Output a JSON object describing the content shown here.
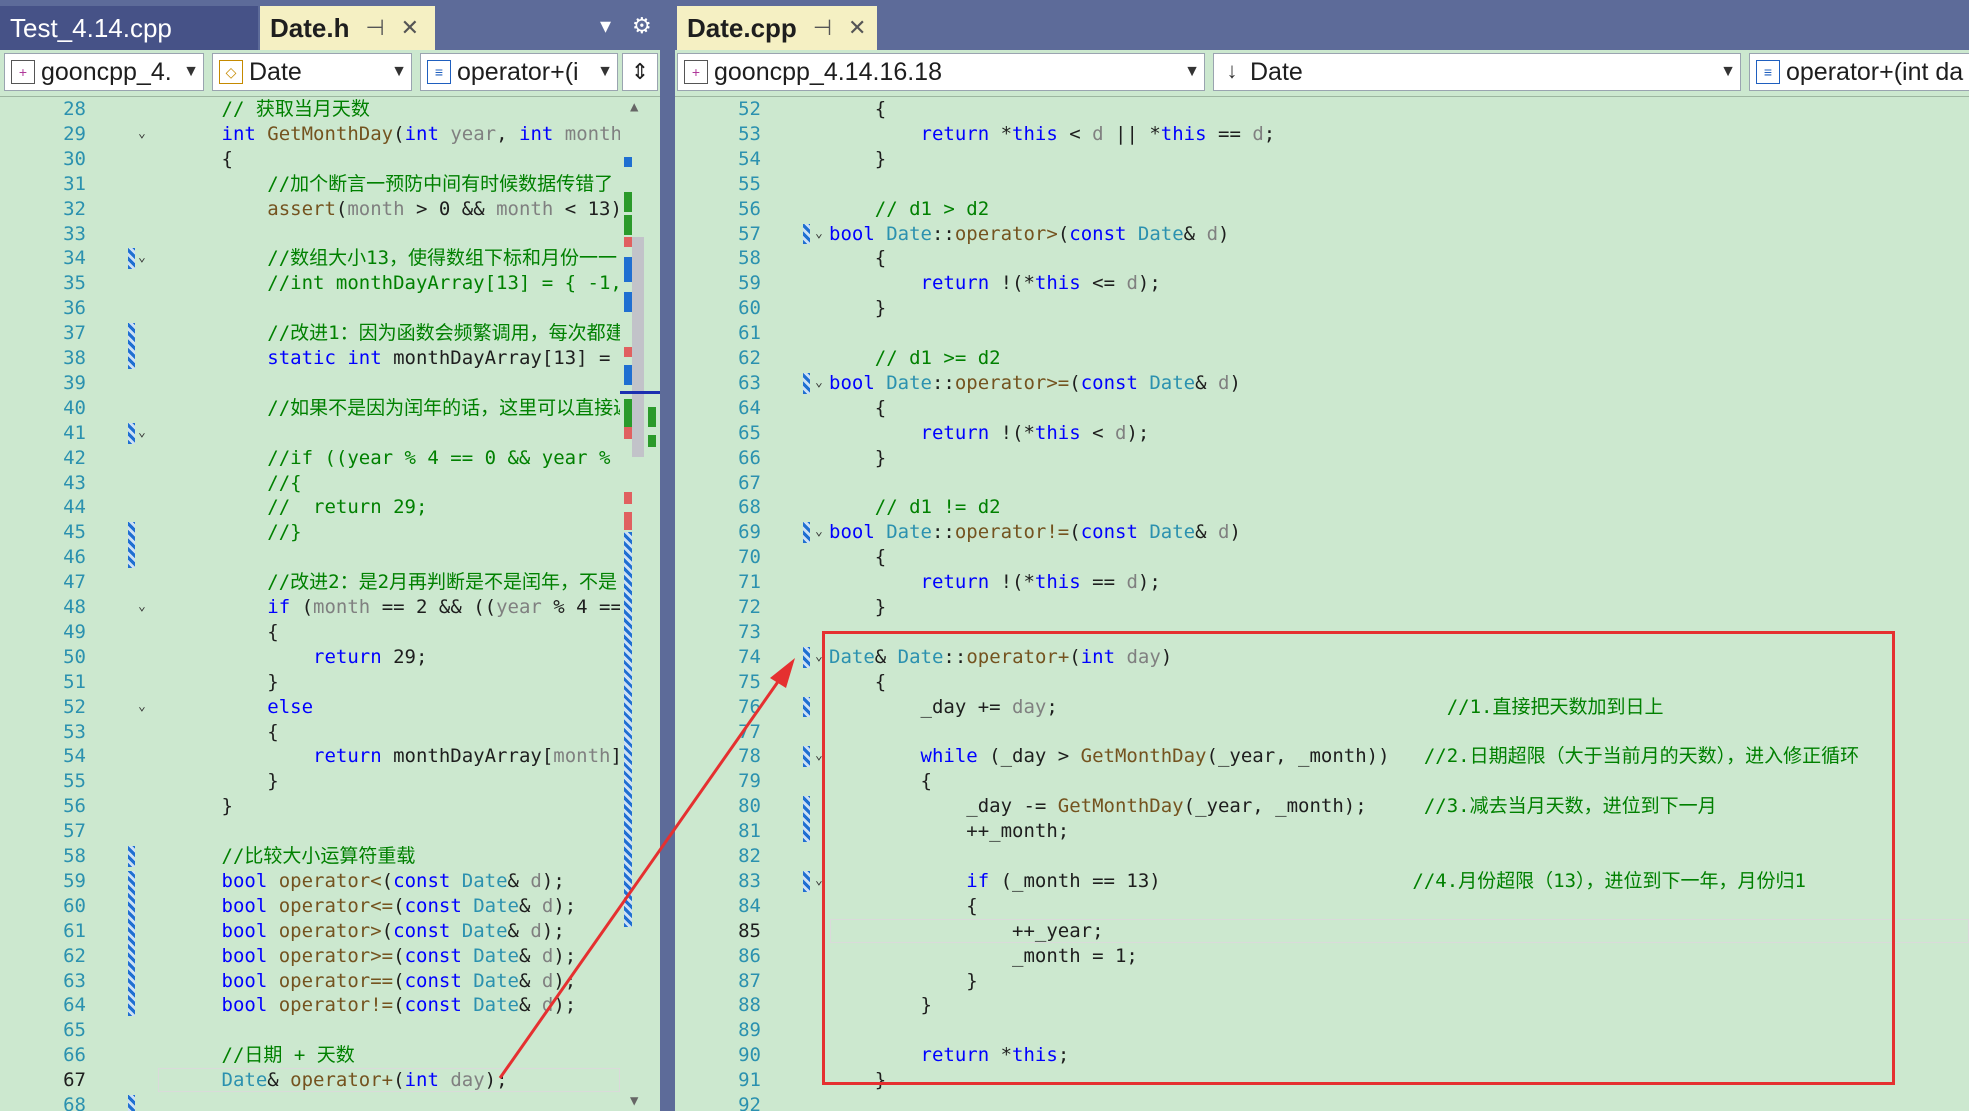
{
  "left_pane": {
    "tabs": [
      {
        "label": "Test_4.14.cpp",
        "active": false
      },
      {
        "label": "Date.h",
        "active": true
      }
    ],
    "tab_pin": "⊣",
    "tab_close": "✕",
    "tab_dropdown": "▾",
    "tab_settings": "⚙",
    "nav": {
      "project": "gooncpp_4.",
      "scope": "Date",
      "member": "operator+(i"
    }
  },
  "right_pane": {
    "tabs": [
      {
        "label": "Date.cpp",
        "active": true
      }
    ],
    "tab_pin": "⊣",
    "tab_close": "✕",
    "nav": {
      "project": "gooncpp_4.14.16.18",
      "scope": "Date",
      "member": "operator+(int da"
    }
  },
  "left_code": [
    {
      "n": "28",
      "parts": [
        [
          "cm",
          "        // 获取当月天数"
        ]
      ]
    },
    {
      "n": "29",
      "parts": [
        [
          "kw",
          "        int "
        ],
        [
          "fn",
          "GetMonthDay"
        ],
        [
          "op",
          "("
        ],
        [
          "kw",
          "int "
        ],
        [
          "pr",
          "year"
        ],
        [
          "op",
          ", "
        ],
        [
          "kw",
          "int "
        ],
        [
          "pr",
          "month"
        ],
        [
          "op",
          ")"
        ]
      ]
    },
    {
      "n": "30",
      "parts": [
        [
          "op",
          "        {"
        ]
      ]
    },
    {
      "n": "31",
      "parts": [
        [
          "cm",
          "            //加个断言一预防中间有时候数据传错了"
        ]
      ]
    },
    {
      "n": "32",
      "parts": [
        [
          "fn",
          "            assert"
        ],
        [
          "op",
          "("
        ],
        [
          "pr",
          "month"
        ],
        [
          "op",
          " > 0 && "
        ],
        [
          "pr",
          "month"
        ],
        [
          "op",
          " < 13);"
        ]
      ]
    },
    {
      "n": "33",
      "parts": [
        [
          "op",
          ""
        ]
      ]
    },
    {
      "n": "34",
      "parts": [
        [
          "cm",
          "            //数组大小13，使得数组下标和月份一一"
        ]
      ]
    },
    {
      "n": "35",
      "parts": [
        [
          "cm",
          "            //int monthDayArray[13] = { -1,"
        ]
      ]
    },
    {
      "n": "36",
      "parts": [
        [
          "op",
          ""
        ]
      ]
    },
    {
      "n": "37",
      "parts": [
        [
          "cm",
          "            //改进1：因为函数会频繁调用，每次都建"
        ]
      ]
    },
    {
      "n": "38",
      "parts": [
        [
          "kw",
          "            static int "
        ],
        [
          "op",
          "monthDayArray[13] = {"
        ]
      ]
    },
    {
      "n": "39",
      "parts": [
        [
          "op",
          ""
        ]
      ]
    },
    {
      "n": "40",
      "parts": [
        [
          "cm",
          "            //如果不是因为闰年的话，这里可以直接返"
        ]
      ]
    },
    {
      "n": "41",
      "parts": [
        [
          "op",
          ""
        ]
      ]
    },
    {
      "n": "42",
      "parts": [
        [
          "cm",
          "            //if ((year % 4 == 0 && year % 1"
        ]
      ]
    },
    {
      "n": "43",
      "parts": [
        [
          "cm",
          "            //{"
        ]
      ]
    },
    {
      "n": "44",
      "parts": [
        [
          "cm",
          "            //  return 29;"
        ]
      ]
    },
    {
      "n": "45",
      "parts": [
        [
          "cm",
          "            //}"
        ]
      ]
    },
    {
      "n": "46",
      "parts": [
        [
          "op",
          ""
        ]
      ]
    },
    {
      "n": "47",
      "parts": [
        [
          "cm",
          "            //改进2：是2月再判断是不是闰年，不是"
        ]
      ]
    },
    {
      "n": "48",
      "parts": [
        [
          "kw",
          "            if "
        ],
        [
          "op",
          "("
        ],
        [
          "pr",
          "month"
        ],
        [
          "op",
          " == 2 && (("
        ],
        [
          "pr",
          "year"
        ],
        [
          "op",
          " % 4 == "
        ]
      ]
    },
    {
      "n": "49",
      "parts": [
        [
          "op",
          "            {"
        ]
      ]
    },
    {
      "n": "50",
      "parts": [
        [
          "kw",
          "                return "
        ],
        [
          "op",
          "29;"
        ]
      ]
    },
    {
      "n": "51",
      "parts": [
        [
          "op",
          "            }"
        ]
      ]
    },
    {
      "n": "52",
      "parts": [
        [
          "kw",
          "            else"
        ]
      ]
    },
    {
      "n": "53",
      "parts": [
        [
          "op",
          "            {"
        ]
      ]
    },
    {
      "n": "54",
      "parts": [
        [
          "kw",
          "                return "
        ],
        [
          "op",
          "monthDayArray["
        ],
        [
          "pr",
          "month"
        ],
        [
          "op",
          "],"
        ]
      ]
    },
    {
      "n": "55",
      "parts": [
        [
          "op",
          "            }"
        ]
      ]
    },
    {
      "n": "56",
      "parts": [
        [
          "op",
          "        }"
        ]
      ]
    },
    {
      "n": "57",
      "parts": [
        [
          "op",
          ""
        ]
      ]
    },
    {
      "n": "58",
      "parts": [
        [
          "cm",
          "        //比较大小运算符重载"
        ]
      ]
    },
    {
      "n": "59",
      "parts": [
        [
          "kw",
          "        bool "
        ],
        [
          "fn",
          "operator<"
        ],
        [
          "op",
          "("
        ],
        [
          "kw",
          "const "
        ],
        [
          "ty",
          "Date"
        ],
        [
          "op",
          "& "
        ],
        [
          "pr",
          "d"
        ],
        [
          "op",
          ");"
        ]
      ]
    },
    {
      "n": "60",
      "parts": [
        [
          "kw",
          "        bool "
        ],
        [
          "fn",
          "operator<="
        ],
        [
          "op",
          "("
        ],
        [
          "kw",
          "const "
        ],
        [
          "ty",
          "Date"
        ],
        [
          "op",
          "& "
        ],
        [
          "pr",
          "d"
        ],
        [
          "op",
          ");"
        ]
      ]
    },
    {
      "n": "61",
      "parts": [
        [
          "kw",
          "        bool "
        ],
        [
          "fn",
          "operator>"
        ],
        [
          "op",
          "("
        ],
        [
          "kw",
          "const "
        ],
        [
          "ty",
          "Date"
        ],
        [
          "op",
          "& "
        ],
        [
          "pr",
          "d"
        ],
        [
          "op",
          ");"
        ]
      ]
    },
    {
      "n": "62",
      "parts": [
        [
          "kw",
          "        bool "
        ],
        [
          "fn",
          "operator>="
        ],
        [
          "op",
          "("
        ],
        [
          "kw",
          "const "
        ],
        [
          "ty",
          "Date"
        ],
        [
          "op",
          "& "
        ],
        [
          "pr",
          "d"
        ],
        [
          "op",
          ");"
        ]
      ]
    },
    {
      "n": "63",
      "parts": [
        [
          "kw",
          "        bool "
        ],
        [
          "fn",
          "operator=="
        ],
        [
          "op",
          "("
        ],
        [
          "kw",
          "const "
        ],
        [
          "ty",
          "Date"
        ],
        [
          "op",
          "& "
        ],
        [
          "pr",
          "d"
        ],
        [
          "op",
          ");"
        ]
      ]
    },
    {
      "n": "64",
      "parts": [
        [
          "kw",
          "        bool "
        ],
        [
          "fn",
          "operator!="
        ],
        [
          "op",
          "("
        ],
        [
          "kw",
          "const "
        ],
        [
          "ty",
          "Date"
        ],
        [
          "op",
          "& "
        ],
        [
          "pr",
          "d"
        ],
        [
          "op",
          ");"
        ]
      ]
    },
    {
      "n": "65",
      "parts": [
        [
          "op",
          ""
        ]
      ]
    },
    {
      "n": "66",
      "parts": [
        [
          "cm",
          "        //日期 + 天数"
        ]
      ]
    },
    {
      "n": "67",
      "parts": [
        [
          "ty",
          "        Date"
        ],
        [
          "op",
          "& "
        ],
        [
          "fn",
          "operator+"
        ],
        [
          "op",
          "("
        ],
        [
          "kw",
          "int "
        ],
        [
          "pr",
          "day"
        ],
        [
          "op",
          ");"
        ]
      ]
    },
    {
      "n": "68",
      "parts": [
        [
          "op",
          ""
        ]
      ]
    }
  ],
  "right_code": [
    {
      "n": "52",
      "parts": [
        [
          "op",
          "    {"
        ]
      ]
    },
    {
      "n": "53",
      "parts": [
        [
          "kw",
          "        return "
        ],
        [
          "op",
          "*"
        ],
        [
          "kw",
          "this"
        ],
        [
          "op",
          " < "
        ],
        [
          "pr",
          "d"
        ],
        [
          "op",
          " || *"
        ],
        [
          "kw",
          "this"
        ],
        [
          "op",
          " == "
        ],
        [
          "pr",
          "d"
        ],
        [
          "op",
          ";"
        ]
      ]
    },
    {
      "n": "54",
      "parts": [
        [
          "op",
          "    }"
        ]
      ]
    },
    {
      "n": "55",
      "parts": [
        [
          "op",
          ""
        ]
      ]
    },
    {
      "n": "56",
      "parts": [
        [
          "cm",
          "    // d1 > d2"
        ]
      ]
    },
    {
      "n": "57",
      "parts": [
        [
          "kw",
          "bool "
        ],
        [
          "ty",
          "Date"
        ],
        [
          "op",
          "::"
        ],
        [
          "fn",
          "operator>"
        ],
        [
          "op",
          "("
        ],
        [
          "kw",
          "const "
        ],
        [
          "ty",
          "Date"
        ],
        [
          "op",
          "& "
        ],
        [
          "pr",
          "d"
        ],
        [
          "op",
          ")"
        ]
      ]
    },
    {
      "n": "58",
      "parts": [
        [
          "op",
          "    {"
        ]
      ]
    },
    {
      "n": "59",
      "parts": [
        [
          "kw",
          "        return "
        ],
        [
          "op",
          "!(*"
        ],
        [
          "kw",
          "this"
        ],
        [
          "op",
          " <= "
        ],
        [
          "pr",
          "d"
        ],
        [
          "op",
          ");"
        ]
      ]
    },
    {
      "n": "60",
      "parts": [
        [
          "op",
          "    }"
        ]
      ]
    },
    {
      "n": "61",
      "parts": [
        [
          "op",
          ""
        ]
      ]
    },
    {
      "n": "62",
      "parts": [
        [
          "cm",
          "    // d1 >= d2"
        ]
      ]
    },
    {
      "n": "63",
      "parts": [
        [
          "kw",
          "bool "
        ],
        [
          "ty",
          "Date"
        ],
        [
          "op",
          "::"
        ],
        [
          "fn",
          "operator>="
        ],
        [
          "op",
          "("
        ],
        [
          "kw",
          "const "
        ],
        [
          "ty",
          "Date"
        ],
        [
          "op",
          "& "
        ],
        [
          "pr",
          "d"
        ],
        [
          "op",
          ")"
        ]
      ]
    },
    {
      "n": "64",
      "parts": [
        [
          "op",
          "    {"
        ]
      ]
    },
    {
      "n": "65",
      "parts": [
        [
          "kw",
          "        return "
        ],
        [
          "op",
          "!(*"
        ],
        [
          "kw",
          "this"
        ],
        [
          "op",
          " < "
        ],
        [
          "pr",
          "d"
        ],
        [
          "op",
          ");"
        ]
      ]
    },
    {
      "n": "66",
      "parts": [
        [
          "op",
          "    }"
        ]
      ]
    },
    {
      "n": "67",
      "parts": [
        [
          "op",
          ""
        ]
      ]
    },
    {
      "n": "68",
      "parts": [
        [
          "cm",
          "    // d1 != d2"
        ]
      ]
    },
    {
      "n": "69",
      "parts": [
        [
          "kw",
          "bool "
        ],
        [
          "ty",
          "Date"
        ],
        [
          "op",
          "::"
        ],
        [
          "fn",
          "operator!="
        ],
        [
          "op",
          "("
        ],
        [
          "kw",
          "const "
        ],
        [
          "ty",
          "Date"
        ],
        [
          "op",
          "& "
        ],
        [
          "pr",
          "d"
        ],
        [
          "op",
          ")"
        ]
      ]
    },
    {
      "n": "70",
      "parts": [
        [
          "op",
          "    {"
        ]
      ]
    },
    {
      "n": "71",
      "parts": [
        [
          "kw",
          "        return "
        ],
        [
          "op",
          "!(*"
        ],
        [
          "kw",
          "this"
        ],
        [
          "op",
          " == "
        ],
        [
          "pr",
          "d"
        ],
        [
          "op",
          ");"
        ]
      ]
    },
    {
      "n": "72",
      "parts": [
        [
          "op",
          "    }"
        ]
      ]
    },
    {
      "n": "73",
      "parts": [
        [
          "op",
          ""
        ]
      ]
    },
    {
      "n": "74",
      "parts": [
        [
          "ty",
          "Date"
        ],
        [
          "op",
          "& "
        ],
        [
          "ty",
          "Date"
        ],
        [
          "op",
          "::"
        ],
        [
          "fn",
          "operator+"
        ],
        [
          "op",
          "("
        ],
        [
          "kw",
          "int "
        ],
        [
          "pr",
          "day"
        ],
        [
          "op",
          ")"
        ]
      ]
    },
    {
      "n": "75",
      "parts": [
        [
          "op",
          "    {"
        ]
      ]
    },
    {
      "n": "76",
      "parts": [
        [
          "op",
          "        _day += "
        ],
        [
          "pr",
          "day"
        ],
        [
          "op",
          ";                                  "
        ],
        [
          "cm",
          "//1.直接把天数加到日上"
        ]
      ]
    },
    {
      "n": "77",
      "parts": [
        [
          "op",
          ""
        ]
      ]
    },
    {
      "n": "78",
      "parts": [
        [
          "kw",
          "        while "
        ],
        [
          "op",
          "(_day > "
        ],
        [
          "fn",
          "GetMonthDay"
        ],
        [
          "op",
          "(_year, _month))   "
        ],
        [
          "cm",
          "//2.日期超限（大于当前月的天数），进入修正循环"
        ]
      ]
    },
    {
      "n": "79",
      "parts": [
        [
          "op",
          "        {"
        ]
      ]
    },
    {
      "n": "80",
      "parts": [
        [
          "op",
          "            _day -= "
        ],
        [
          "fn",
          "GetMonthDay"
        ],
        [
          "op",
          "(_year, _month);     "
        ],
        [
          "cm",
          "//3.减去当月天数，进位到下一月"
        ]
      ]
    },
    {
      "n": "81",
      "parts": [
        [
          "op",
          "            ++_month;"
        ]
      ]
    },
    {
      "n": "82",
      "parts": [
        [
          "op",
          ""
        ]
      ]
    },
    {
      "n": "83",
      "parts": [
        [
          "kw",
          "            if "
        ],
        [
          "op",
          "(_month == 13)                      "
        ],
        [
          "cm",
          "//4.月份超限（13），进位到下一年，月份归1"
        ]
      ]
    },
    {
      "n": "84",
      "parts": [
        [
          "op",
          "            {"
        ]
      ]
    },
    {
      "n": "85",
      "parts": [
        [
          "op",
          "                ++_year;"
        ]
      ]
    },
    {
      "n": "86",
      "parts": [
        [
          "op",
          "                _month = 1;"
        ]
      ]
    },
    {
      "n": "87",
      "parts": [
        [
          "op",
          "            }"
        ]
      ]
    },
    {
      "n": "88",
      "parts": [
        [
          "op",
          "        }"
        ]
      ]
    },
    {
      "n": "89",
      "parts": [
        [
          "op",
          ""
        ]
      ]
    },
    {
      "n": "90",
      "parts": [
        [
          "kw",
          "        return "
        ],
        [
          "op",
          "*"
        ],
        [
          "kw",
          "this"
        ],
        [
          "op",
          ";"
        ]
      ]
    },
    {
      "n": "91",
      "parts": [
        [
          "op",
          "    }"
        ]
      ]
    },
    {
      "n": "92",
      "parts": [
        [
          "op",
          ""
        ]
      ]
    }
  ],
  "left_current_line": "67",
  "right_current_line": "85"
}
